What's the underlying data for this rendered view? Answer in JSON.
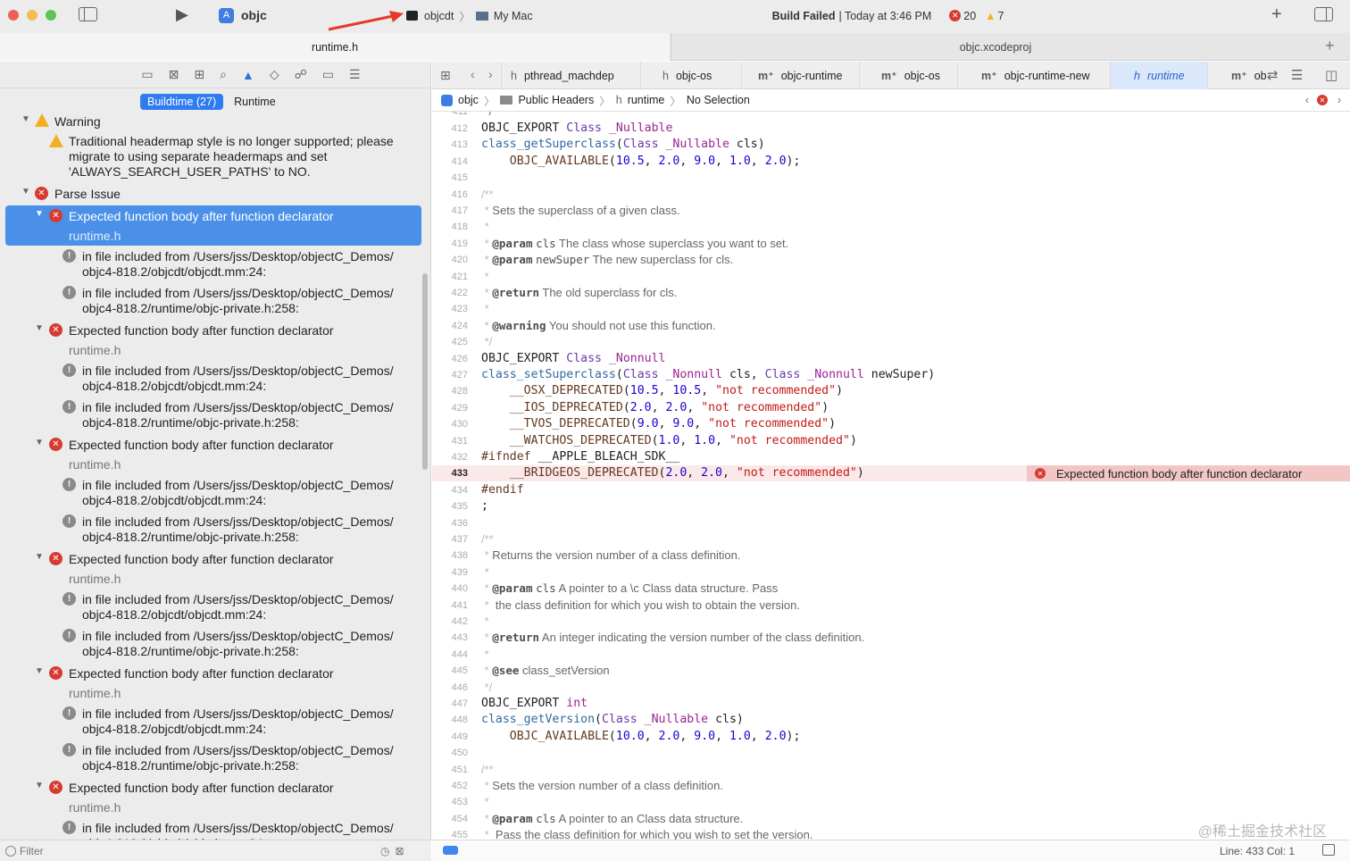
{
  "toolbar": {
    "scheme_name": "objc",
    "target": "objcdt",
    "destination": "My Mac",
    "build_status_bold": "Build Failed",
    "build_status_time": "| Today at 3:46 PM",
    "error_count": "20",
    "warning_count": "7"
  },
  "window_tabs": {
    "left": "runtime.h",
    "right": "objc.xcodeproj"
  },
  "navigator": {
    "seg_buildtime": "Buildtime (27)",
    "seg_runtime": "Runtime",
    "filter_placeholder": "Filter",
    "warning_group": "Warning",
    "warning_text_1": "Traditional headermap style is no longer supported; please",
    "warning_text_2": "migrate to using separate headermaps and set",
    "warning_text_3": "'ALWAYS_SEARCH_USER_PATHS' to NO.",
    "parse_group": "Parse Issue",
    "error_title": "Expected function body after function declarator",
    "error_file": "runtime.h",
    "note1_line1": "in file included from /Users/jss/Desktop/objectC_Demos/",
    "note1_line2": "objc4-818.2/objcdt/objcdt.mm:24:",
    "note2_line1": "in file included from /Users/jss/Desktop/objectC_Demos/",
    "note2_line2": "objc4-818.2/runtime/objc-private.h:258:"
  },
  "editor_tabs": [
    "pthread_machdep",
    "objc-os",
    "objc-runtime",
    "objc-os",
    "objc-runtime-new",
    "runtime",
    "ob"
  ],
  "jumpbar": {
    "project": "objc",
    "group": "Public Headers",
    "file": "runtime",
    "selection": "No Selection"
  },
  "code": {
    "error_message": "Expected function body after function declarator",
    "current_line": "433",
    "lines": [
      {
        "n": "412",
        "t": "OBJC_EXPORT Class _Nullable"
      },
      {
        "n": "413",
        "t": "class_getSuperclass(Class _Nullable cls)"
      },
      {
        "n": "414",
        "t": "    OBJC_AVAILABLE(10.5, 2.0, 9.0, 1.0, 2.0);"
      },
      {
        "n": "415",
        "t": ""
      },
      {
        "n": "416",
        "t": "/**"
      },
      {
        "n": "417",
        "t": " * Sets the superclass of a given class."
      },
      {
        "n": "418",
        "t": " *"
      },
      {
        "n": "419",
        "t": " * @param cls The class whose superclass you want to set."
      },
      {
        "n": "420",
        "t": " * @param newSuper The new superclass for cls."
      },
      {
        "n": "421",
        "t": " *"
      },
      {
        "n": "422",
        "t": " * @return The old superclass for cls."
      },
      {
        "n": "423",
        "t": " *"
      },
      {
        "n": "424",
        "t": " * @warning You should not use this function."
      },
      {
        "n": "425",
        "t": " */"
      },
      {
        "n": "426",
        "t": "OBJC_EXPORT Class _Nonnull"
      },
      {
        "n": "427",
        "t": "class_setSuperclass(Class _Nonnull cls, Class _Nonnull newSuper)"
      },
      {
        "n": "428",
        "t": "    __OSX_DEPRECATED(10.5, 10.5, \"not recommended\")"
      },
      {
        "n": "429",
        "t": "    __IOS_DEPRECATED(2.0, 2.0, \"not recommended\")"
      },
      {
        "n": "430",
        "t": "    __TVOS_DEPRECATED(9.0, 9.0, \"not recommended\")"
      },
      {
        "n": "431",
        "t": "    __WATCHOS_DEPRECATED(1.0, 1.0, \"not recommended\")"
      },
      {
        "n": "432",
        "t": "#ifndef __APPLE_BLEACH_SDK__"
      },
      {
        "n": "433",
        "t": "    __BRIDGEOS_DEPRECATED(2.0, 2.0, \"not recommended\")"
      },
      {
        "n": "434",
        "t": "#endif"
      },
      {
        "n": "435",
        "t": ";"
      },
      {
        "n": "436",
        "t": ""
      },
      {
        "n": "437",
        "t": "/**"
      },
      {
        "n": "438",
        "t": " * Returns the version number of a class definition."
      },
      {
        "n": "439",
        "t": " *"
      },
      {
        "n": "440",
        "t": " * @param cls A pointer to a \\c Class data structure. Pass"
      },
      {
        "n": "441",
        "t": " *  the class definition for which you wish to obtain the version."
      },
      {
        "n": "442",
        "t": " *"
      },
      {
        "n": "443",
        "t": " * @return An integer indicating the version number of the class definition."
      },
      {
        "n": "444",
        "t": " *"
      },
      {
        "n": "445",
        "t": " * @see class_setVersion"
      },
      {
        "n": "446",
        "t": " */"
      },
      {
        "n": "447",
        "t": "OBJC_EXPORT int"
      },
      {
        "n": "448",
        "t": "class_getVersion(Class _Nullable cls)"
      },
      {
        "n": "449",
        "t": "    OBJC_AVAILABLE(10.0, 2.0, 9.0, 1.0, 2.0);"
      },
      {
        "n": "450",
        "t": ""
      },
      {
        "n": "451",
        "t": "/**"
      },
      {
        "n": "452",
        "t": " * Sets the version number of a class definition."
      },
      {
        "n": "453",
        "t": " *"
      },
      {
        "n": "454",
        "t": " * @param cls A pointer to an Class data structure."
      },
      {
        "n": "455",
        "t": " *  Pass the class definition for which you wish to set the version."
      }
    ]
  },
  "status": {
    "position": "Line: 433  Col: 1"
  },
  "watermark": "@稀土掘金技术社区"
}
